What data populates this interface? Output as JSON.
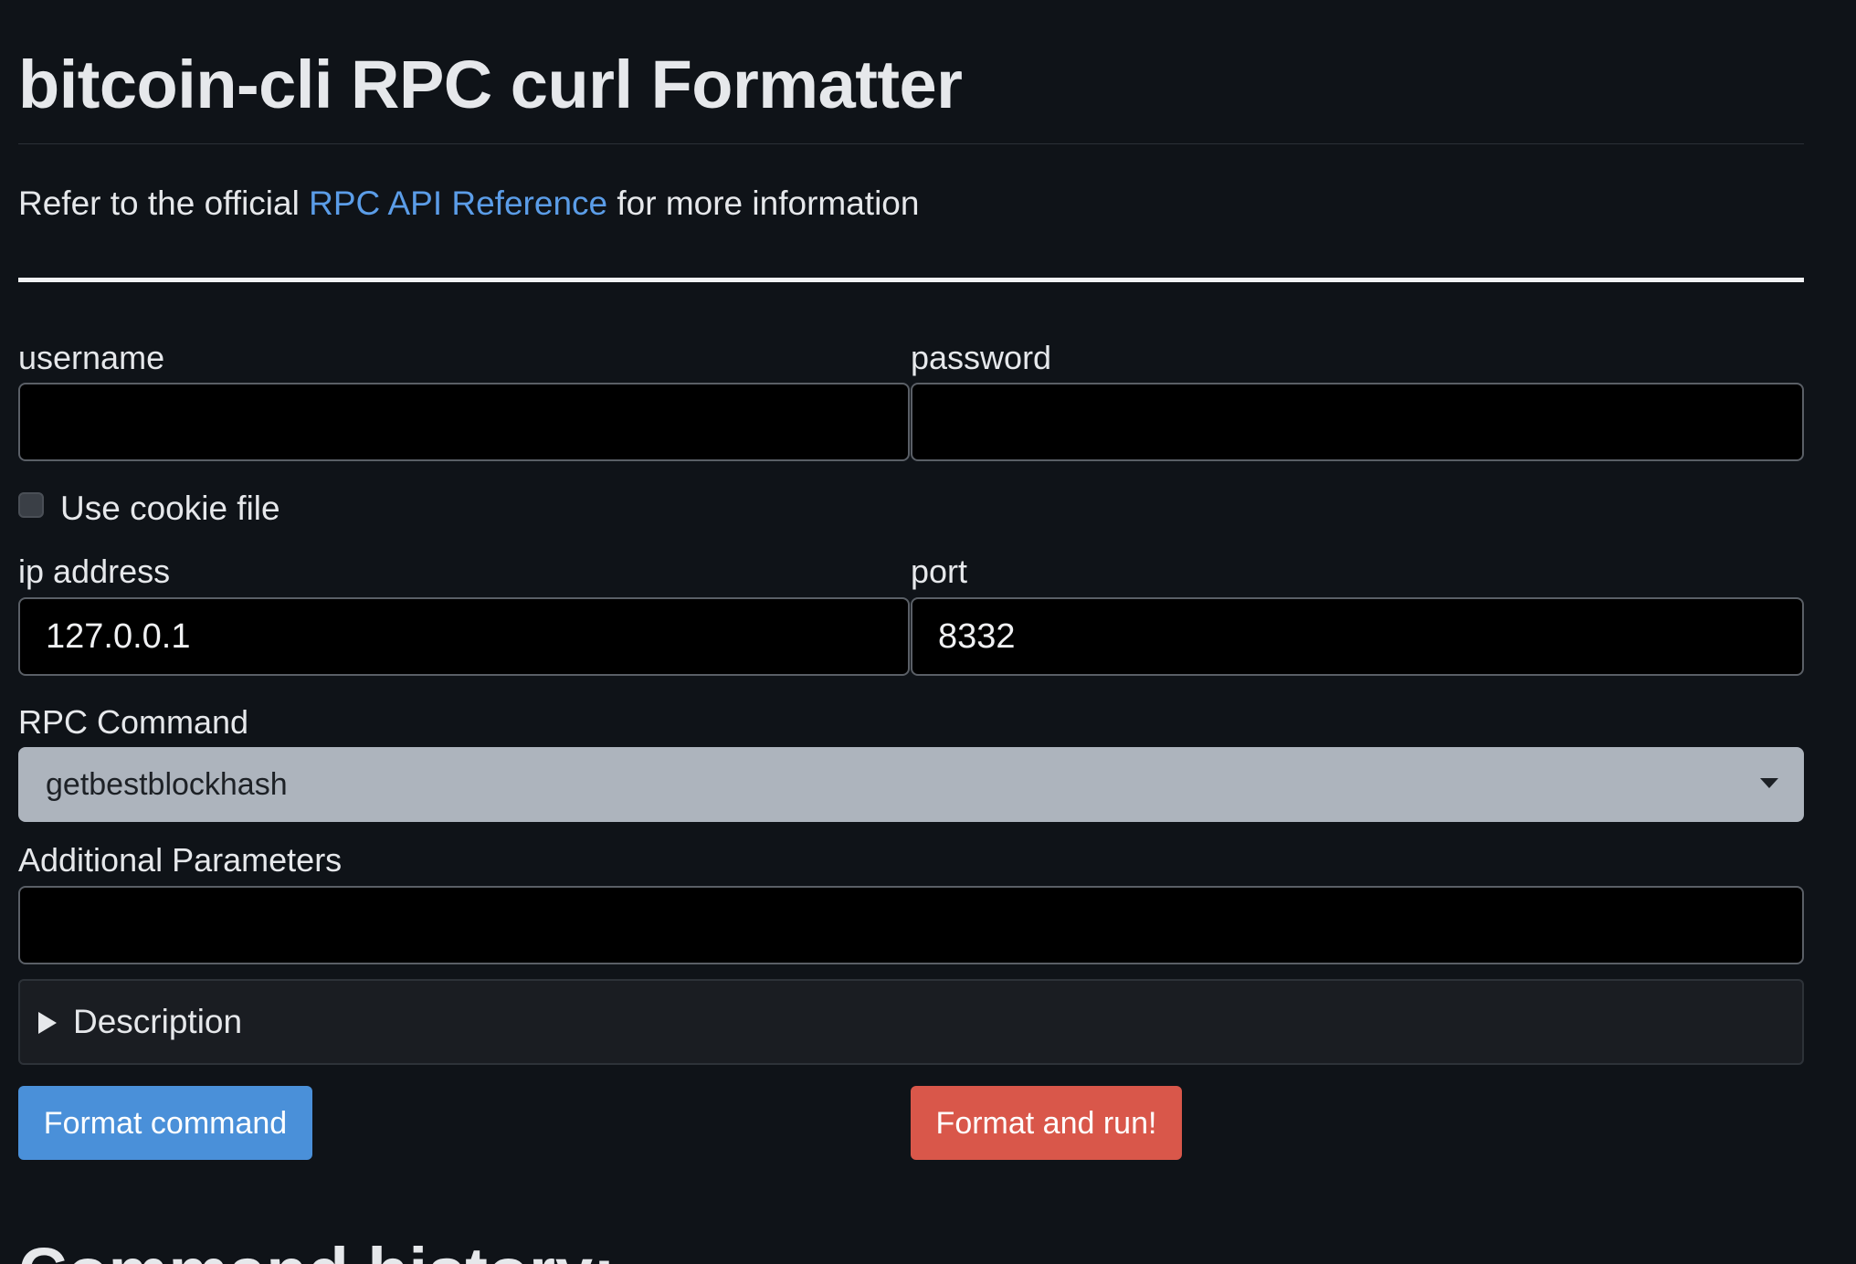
{
  "header": {
    "title": "bitcoin-cli RPC curl Formatter",
    "intro_prefix": "Refer to the official ",
    "intro_link": "RPC API Reference",
    "intro_suffix": " for more information"
  },
  "form": {
    "username": {
      "label": "username",
      "value": ""
    },
    "password": {
      "label": "password",
      "value": ""
    },
    "cookie": {
      "label": "Use cookie file",
      "checked": false
    },
    "ip": {
      "label": "ip address",
      "value": "127.0.0.1"
    },
    "port": {
      "label": "port",
      "value": "8332"
    },
    "rpc_command": {
      "label": "RPC Command",
      "selected": "getbestblockhash"
    },
    "additional": {
      "label": "Additional Parameters",
      "value": ""
    },
    "description": {
      "summary": "Description",
      "expanded": false
    }
  },
  "actions": {
    "format_label": "Format command",
    "run_label": "Format and run!"
  },
  "history": {
    "title": "Command history:"
  },
  "colors": {
    "background": "#0f1318",
    "link": "#5b9de8",
    "primary_button": "#4a90d9",
    "danger_button": "#d9574a",
    "select_bg": "#adb4bd"
  }
}
